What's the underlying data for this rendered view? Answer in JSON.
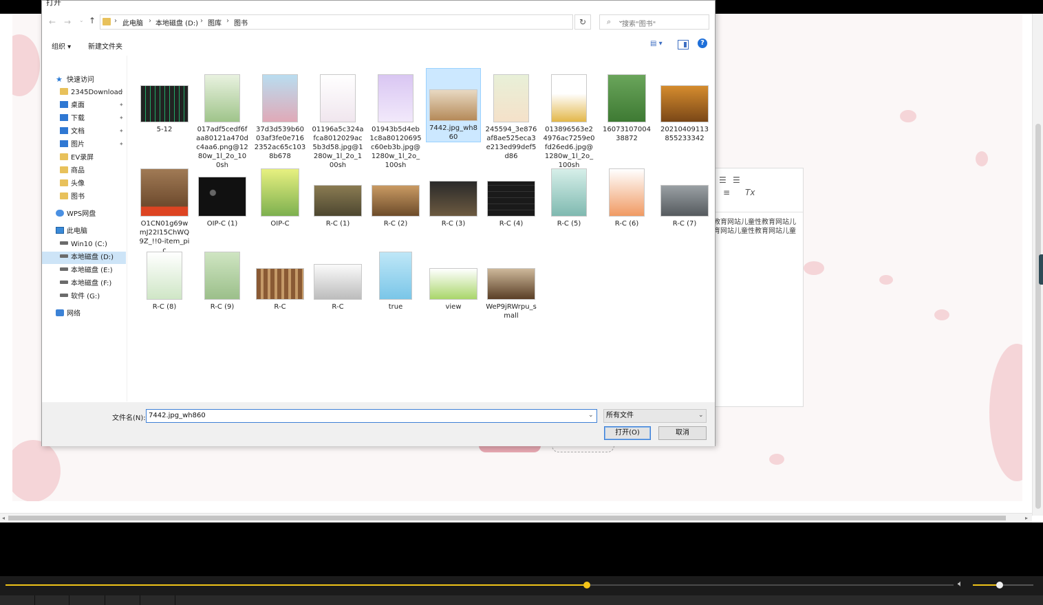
{
  "dialog": {
    "title": "打开",
    "breadcrumb": [
      "此电脑",
      "本地磁盘 (D:)",
      "图库",
      "图书"
    ],
    "search_placeholder": "搜索\"图书\"",
    "commands": {
      "organize": "组织 ▾",
      "new_folder": "新建文件夹"
    },
    "nav": [
      {
        "label": "快速访问",
        "icon": "star-icon"
      },
      {
        "label": "2345Download",
        "icon": "folder-icon"
      },
      {
        "label": "桌面",
        "icon": "desktop-icon"
      },
      {
        "label": "下载",
        "icon": "download-icon"
      },
      {
        "label": "文档",
        "icon": "document-icon"
      },
      {
        "label": "图片",
        "icon": "picture-icon"
      },
      {
        "label": "EV录屏",
        "icon": "folder-icon"
      },
      {
        "label": "商品",
        "icon": "folder-icon"
      },
      {
        "label": "头像",
        "icon": "folder-icon"
      },
      {
        "label": "图书",
        "icon": "folder-icon"
      },
      {
        "label": "WPS网盘",
        "icon": "cloud-icon"
      },
      {
        "label": "此电脑",
        "icon": "computer-icon"
      },
      {
        "label": "Win10 (C:)",
        "icon": "drive-icon"
      },
      {
        "label": "本地磁盘 (D:)",
        "icon": "drive-icon"
      },
      {
        "label": "本地磁盘 (E:)",
        "icon": "drive-icon"
      },
      {
        "label": "本地磁盘 (F:)",
        "icon": "drive-icon"
      },
      {
        "label": "软件 (G:)",
        "icon": "drive-icon"
      },
      {
        "label": "网络",
        "icon": "network-icon"
      }
    ],
    "files": [
      {
        "name": "5-12"
      },
      {
        "name": "017adf5cedf6faa80121a470dc4aa6.png@1280w_1l_2o_100sh"
      },
      {
        "name": "37d3d539b6003af3fe0e7162352ac65c1038b678"
      },
      {
        "name": "01196a5c324afca8012029ac5b3d58.jpg@1280w_1l_2o_100sh"
      },
      {
        "name": "01943b5d4eb1c8a80120695c60eb3b.jpg@1280w_1l_2o_100sh"
      },
      {
        "name": "7442.jpg_wh860"
      },
      {
        "name": "245594_3e876af8ae525eca3e213ed99def5d86"
      },
      {
        "name": "013896563e24976ac7259e0fd26ed6.jpg@1280w_1l_2o_100sh"
      },
      {
        "name": "1607310700438872"
      },
      {
        "name": "20210409113855233342"
      },
      {
        "name": "O1CN01g69wmJ22I15ChWQ9Z_!!0-item_pic"
      },
      {
        "name": "OIP-C (1)"
      },
      {
        "name": "OIP-C"
      },
      {
        "name": "R-C (1)"
      },
      {
        "name": "R-C (2)"
      },
      {
        "name": "R-C (3)"
      },
      {
        "name": "R-C (4)"
      },
      {
        "name": "R-C (5)"
      },
      {
        "name": "R-C (6)"
      },
      {
        "name": "R-C (7)"
      },
      {
        "name": "R-C (8)"
      },
      {
        "name": "R-C (9)"
      },
      {
        "name": "R-C"
      },
      {
        "name": "R-C"
      },
      {
        "name": "true"
      },
      {
        "name": "view"
      },
      {
        "name": "WeP9jRWrpu_small"
      }
    ],
    "filename_label": "文件名(N):",
    "filename_value": "7442.jpg_wh860",
    "filter_value": "所有文件",
    "open_label": "打开(O)",
    "cancel_label": "取消"
  },
  "background": {
    "editor_text": "教育网站儿童性教育网站儿育网站儿童性教育网站儿童"
  },
  "player": {
    "progress": 0.613,
    "volume": 0.44
  },
  "colors": {
    "accent": "#0078d7",
    "selection": "#cce8ff",
    "player_progress": "#f0c419"
  }
}
